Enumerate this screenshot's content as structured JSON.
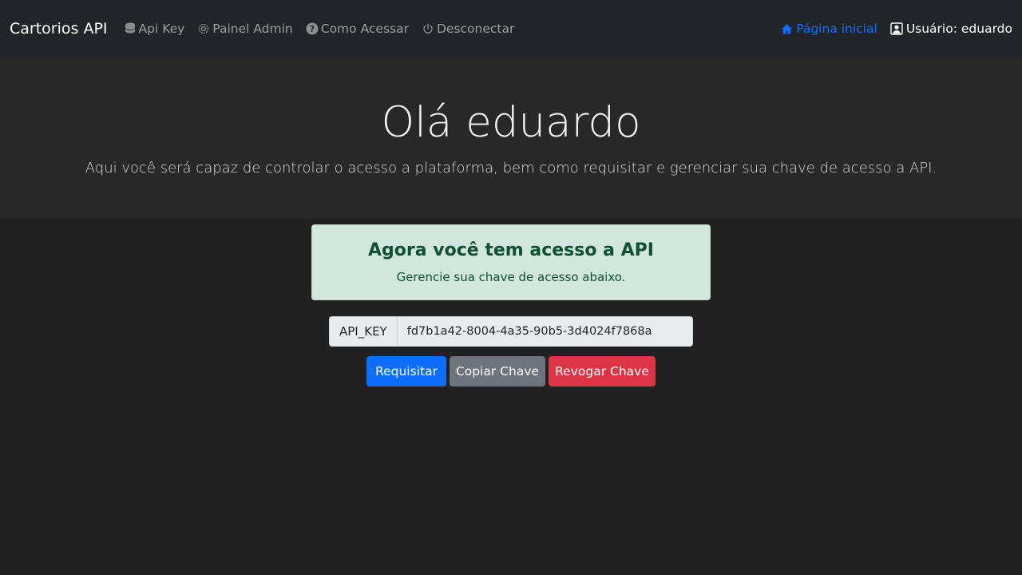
{
  "navbar": {
    "brand": "Cartorios API",
    "links": [
      {
        "label": "Api Key",
        "icon": "database-icon"
      },
      {
        "label": "Painel Admin",
        "icon": "gear-icon"
      },
      {
        "label": "Como Acessar",
        "icon": "question-circle-icon"
      },
      {
        "label": "Desconectar",
        "icon": "power-icon"
      }
    ],
    "home_label": "Página inicial",
    "user_label": "Usuário: eduardo"
  },
  "hero": {
    "title": "Olá eduardo",
    "subtitle": "Aqui você será capaz de controlar o acesso a plataforma, bem como requisitar e gerenciar sua chave de acesso a API."
  },
  "alert": {
    "heading": "Agora você tem acesso a API",
    "text": "Gerencie sua chave de acesso abaixo."
  },
  "api_key": {
    "label": "API_KEY",
    "value": "fd7b1a42-8004-4a35-90b5-3d4024f7868a"
  },
  "actions": {
    "request_label": "Requisitar",
    "copy_label": "Copiar Chave",
    "revoke_label": "Revogar Chave"
  },
  "colors": {
    "navbar_bg": "#212529",
    "page_bg": "#212121",
    "hero_bg": "#282828",
    "primary": "#0d6efd",
    "secondary": "#6c757d",
    "danger": "#dc3545",
    "success_bg": "#d1e7dd",
    "success_text": "#0f5132"
  }
}
